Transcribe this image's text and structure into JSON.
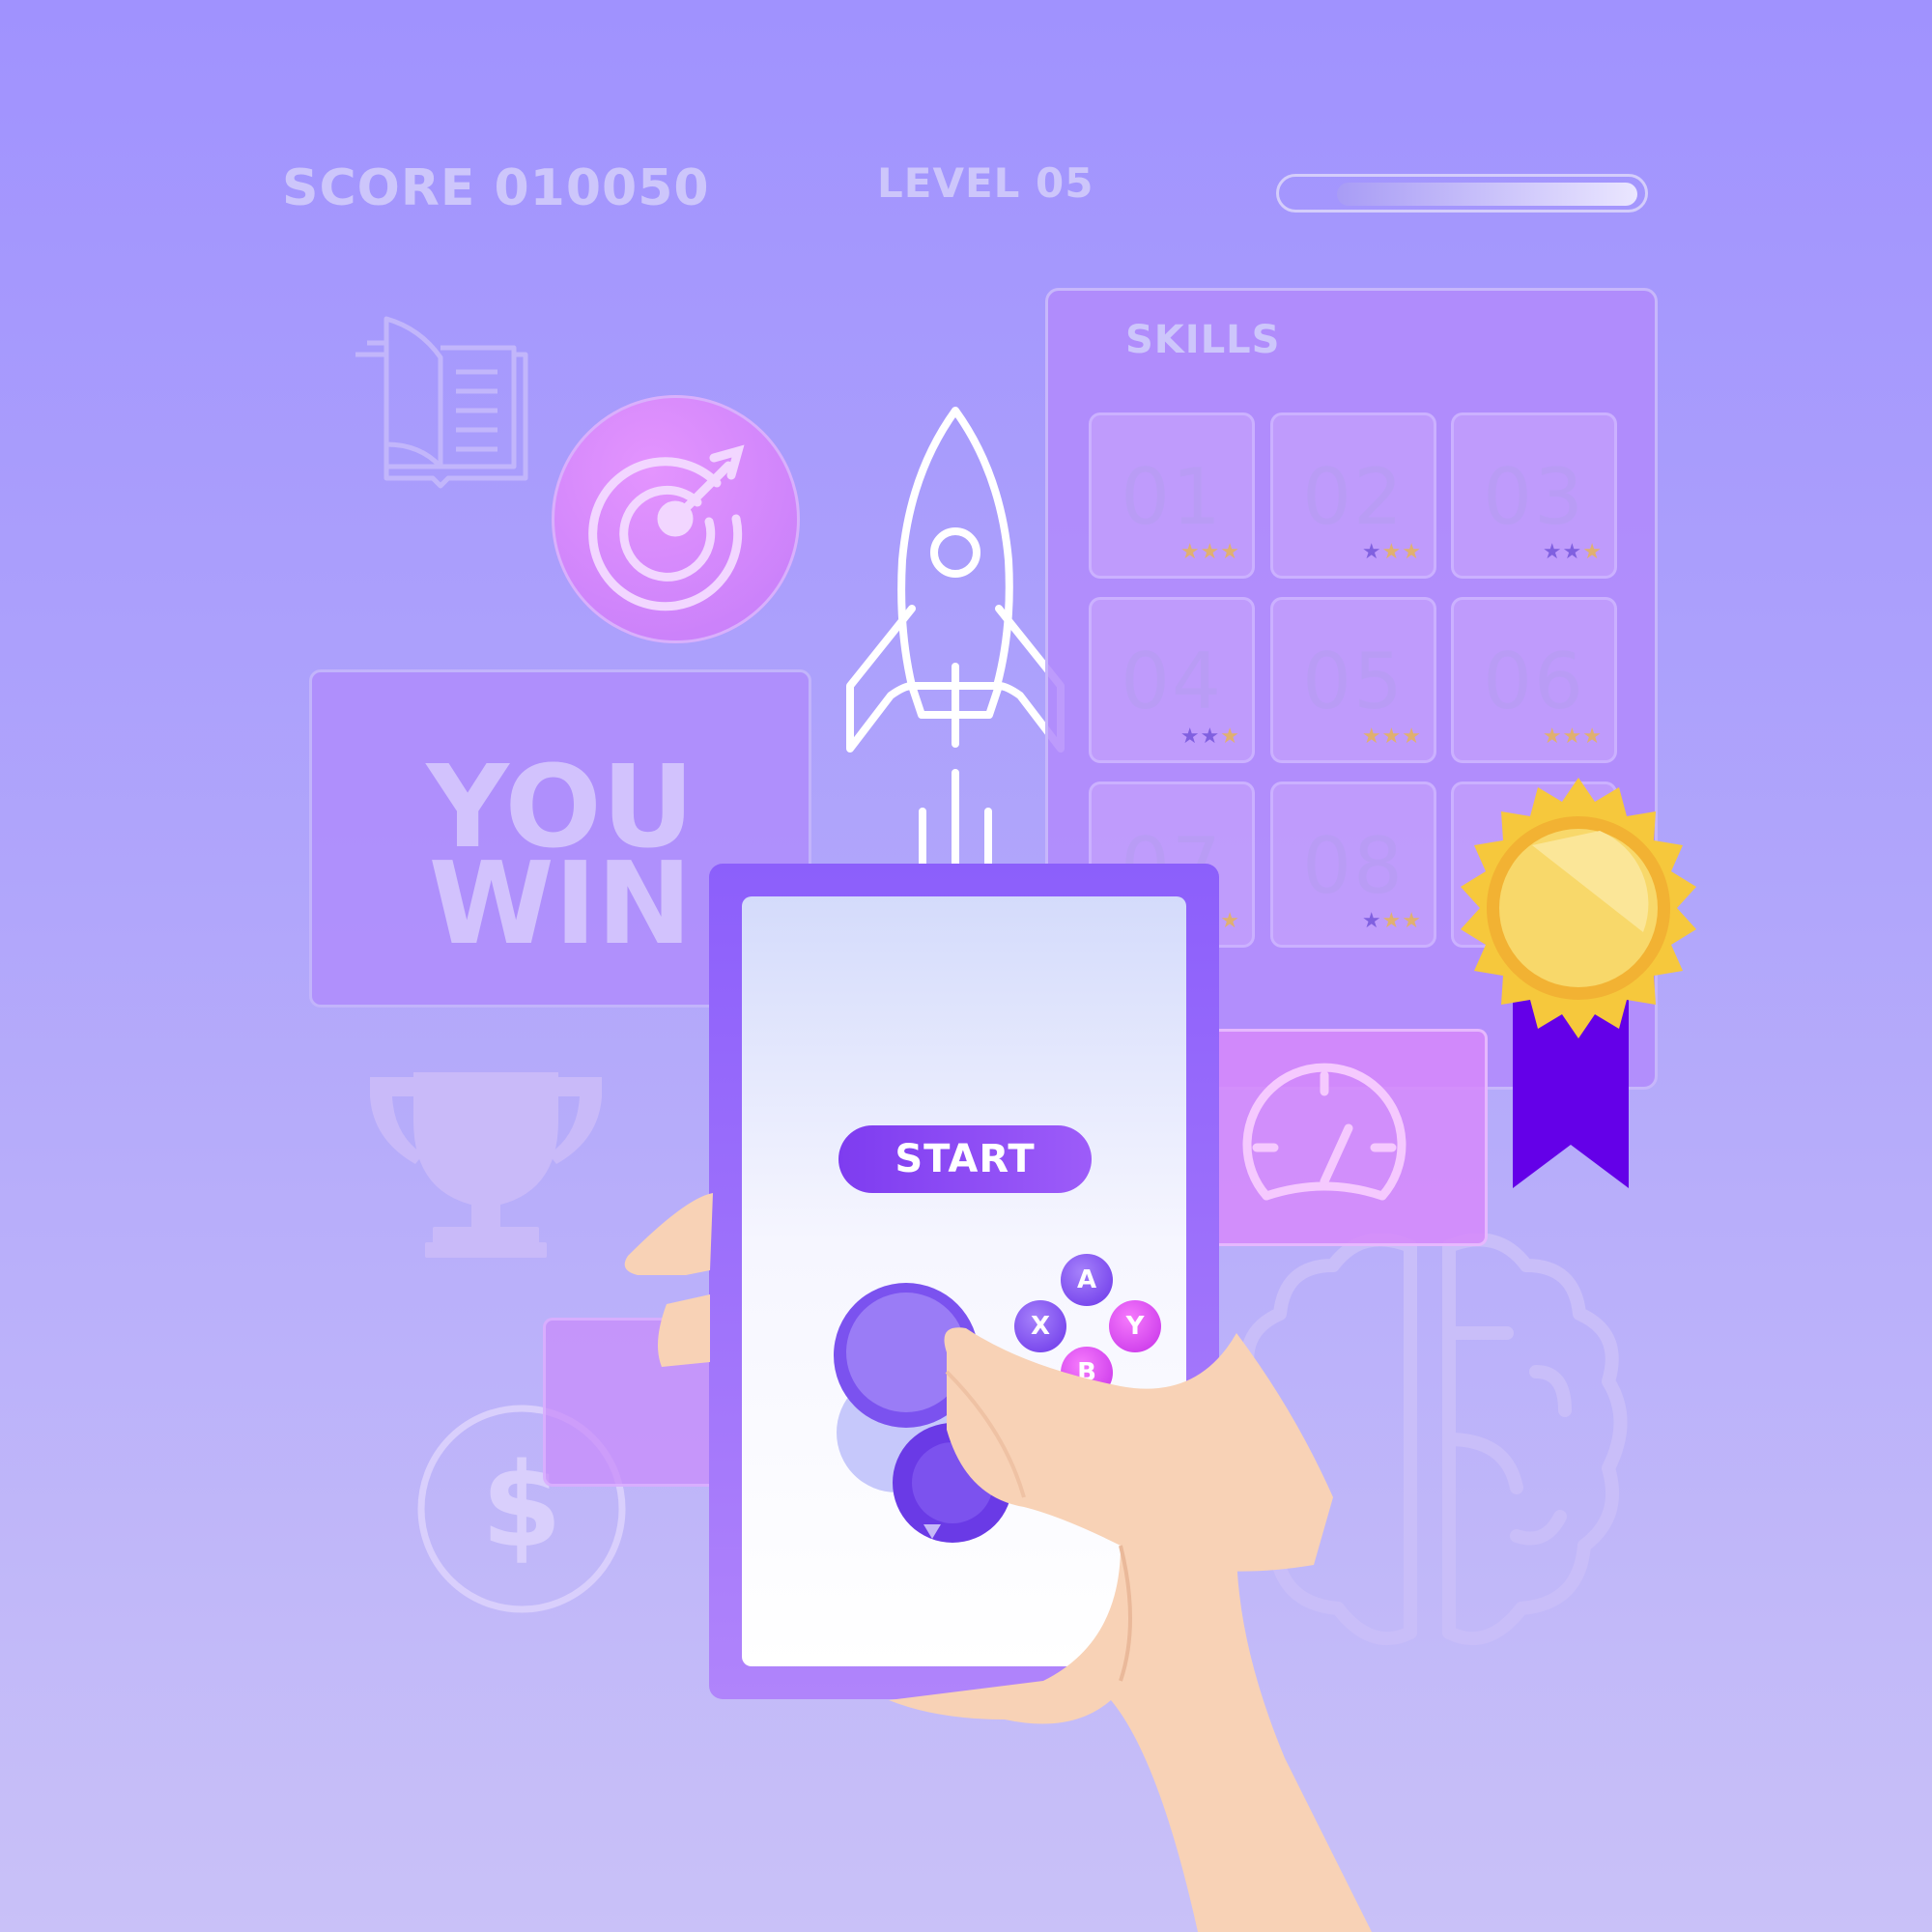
{
  "hud": {
    "score": "SCORE 010050",
    "level": "LEVEL 05",
    "progress": 0.85
  },
  "skills": {
    "title": "SKILLS",
    "tiles": [
      {
        "label": "01",
        "stars": 1
      },
      {
        "label": "02",
        "stars": 2
      },
      {
        "label": "03",
        "stars": 1
      },
      {
        "label": "04",
        "stars": 1
      },
      {
        "label": "05",
        "stars": 3
      },
      {
        "label": "06",
        "stars": 3
      },
      {
        "label": "07",
        "stars": 2
      },
      {
        "label": "08",
        "stars": 2
      }
    ]
  },
  "win_panel": {
    "line1": "YOU",
    "line2": "WIN"
  },
  "phone": {
    "start_label": "START",
    "buttons": {
      "a": "A",
      "x": "X",
      "y": "Y",
      "b": "B"
    }
  },
  "icons": [
    "book-icon",
    "target-icon",
    "rocket-icon",
    "trophy-icon",
    "dollar-icon",
    "speedometer-icon",
    "brain-icon",
    "award-badge-icon",
    "hand-icon",
    "joystick-icon"
  ],
  "colors": {
    "background_top": "#a092fe",
    "background_bottom": "#c9c1f8",
    "accent_purple": "#8c5ffb",
    "start_button": "#7e3cf0",
    "medal_gold": "#f6c83c",
    "ribbon": "#6400e8",
    "star_gold": "#e0b070",
    "star_purple": "#8060e0"
  }
}
